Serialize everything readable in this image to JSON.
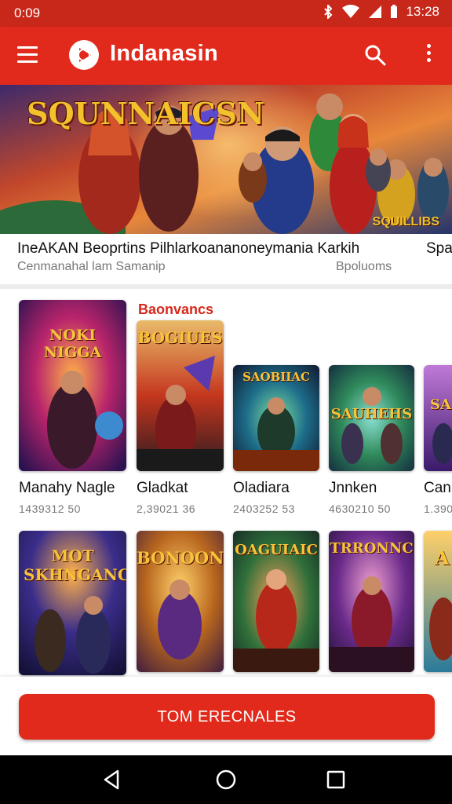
{
  "status_bar": {
    "time": "0:09",
    "clock": "13:28"
  },
  "app_bar": {
    "title": "Indanasin"
  },
  "hero": {
    "banner_title": "SQUNNAICSN",
    "badge": "SQUILLIBS",
    "caption_title": "IneAKAN Beoprtins Pilhlarkoananoneymania Karkih",
    "caption_title_cutoff": "Spa",
    "caption_subtitle": "Cenmanahal lam Samanip",
    "caption_right": "Bpoluoms"
  },
  "section_label": "Baonvancs",
  "games_row1": [
    {
      "name": "Manahy Nagle",
      "meta": "1439312 50",
      "art": "NOKI NIGGA",
      "accent": "#b8246b"
    },
    {
      "name": "Gladkat",
      "meta": "2,39021 36",
      "art": "BOGIUES",
      "accent": "#c4361e"
    },
    {
      "name": "Oladiara",
      "meta": "2403252 53",
      "art": "SAOBIIAC",
      "accent": "#1d6d8a"
    },
    {
      "name": "Jnnken",
      "meta": "4630210 50",
      "art": "SAUHEHS",
      "accent": "#2f8a5b"
    },
    {
      "name": "Can",
      "meta": "1.390",
      "art": "SA",
      "accent": "#7a3da0"
    }
  ],
  "games_row2": [
    {
      "art": "MOT SKHNGANC",
      "accent": "#3a2d8a"
    },
    {
      "art": "BONOON",
      "accent": "#b8661e"
    },
    {
      "art": "OAGUIAIC",
      "accent": "#2f6f3a"
    },
    {
      "art": "TRRONNC",
      "accent": "#6a2a8a"
    },
    {
      "art": "A",
      "accent": "#2a7a9a"
    }
  ],
  "cta": {
    "label": "TOM ERECNALES"
  }
}
